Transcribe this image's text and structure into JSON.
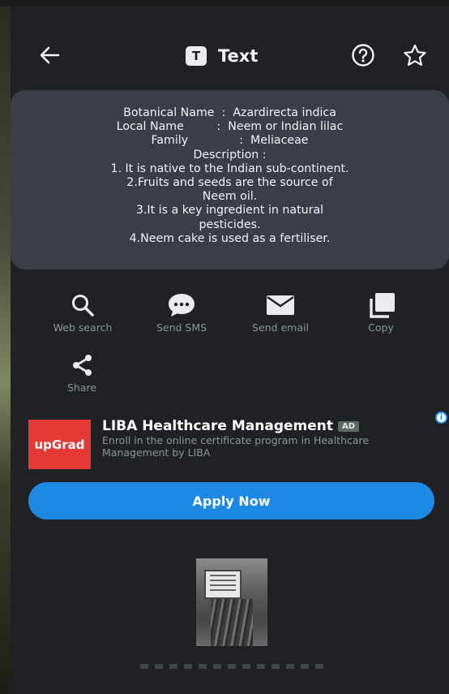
{
  "header": {
    "title": "Text",
    "badge_letter": "T",
    "back_icon": "arrow-left-icon",
    "help_icon": "question-circle-icon",
    "favorite_icon": "star-outline-icon"
  },
  "recognized_text": {
    "lines": [
      "Botanical Name  :  Azardirecta indica",
      "Local Name         :  Neem or Indian lilac",
      "Family              :  Meliaceae",
      "",
      "Description :",
      "1. It is native to the Indian sub-continent.",
      "2.Fruits and seeds are the source of",
      "Neem oil.",
      "3.It is a key ingredient in natural",
      "pesticides.",
      "4.Neem cake is used as a fertiliser."
    ]
  },
  "actions": [
    {
      "label": "Web search",
      "icon": "search-icon"
    },
    {
      "label": "Send SMS",
      "icon": "chat-bubble-icon"
    },
    {
      "label": "Send email",
      "icon": "envelope-icon"
    },
    {
      "label": "Copy",
      "icon": "copy-icon"
    },
    {
      "label": "Share",
      "icon": "share-icon"
    }
  ],
  "ad": {
    "info_glyph": "i",
    "logo_text": "upGrad",
    "title": "LIBA Healthcare Management",
    "tag": "AD",
    "description": "Enroll in the online certificate program in Healthcare Management by LIBA",
    "cta": "Apply Now"
  },
  "colors": {
    "panel": "#1f2125",
    "card": "#3a3e46",
    "accent": "#1e88e5",
    "ad_logo": "#e53935"
  }
}
